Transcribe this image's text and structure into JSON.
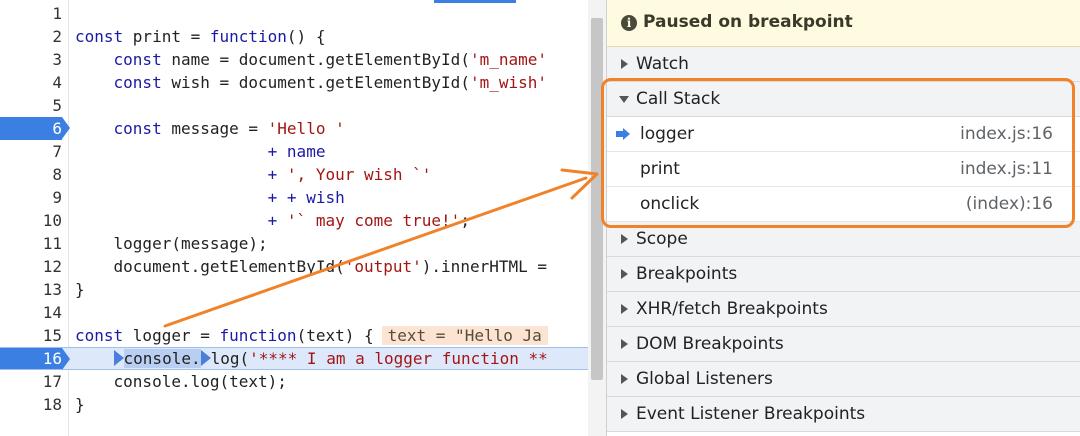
{
  "editor": {
    "lines": [
      {
        "n": "1",
        "parts": []
      },
      {
        "n": "2",
        "parts": [
          [
            "kw",
            "const "
          ],
          [
            "",
            "print = "
          ],
          [
            "kw",
            "function"
          ],
          [
            "",
            "() {"
          ]
        ]
      },
      {
        "n": "3",
        "parts": [
          [
            "",
            "    "
          ],
          [
            "kw",
            "const "
          ],
          [
            "",
            "name = document.getElementById("
          ],
          [
            "str",
            "'m_name'"
          ]
        ]
      },
      {
        "n": "4",
        "parts": [
          [
            "",
            "    "
          ],
          [
            "kw",
            "const "
          ],
          [
            "",
            "wish = document.getElementById("
          ],
          [
            "str",
            "'m_wish'"
          ]
        ]
      },
      {
        "n": "5",
        "parts": []
      },
      {
        "n": "6",
        "bp": true,
        "parts": [
          [
            "",
            "    "
          ],
          [
            "kw",
            "const "
          ],
          [
            "",
            "message = "
          ],
          [
            "str",
            "'Hello '"
          ]
        ]
      },
      {
        "n": "7",
        "parts": [
          [
            "",
            "                    "
          ],
          [
            "kw",
            "+ name"
          ]
        ]
      },
      {
        "n": "8",
        "parts": [
          [
            "",
            "                    "
          ],
          [
            "kw",
            "+ "
          ],
          [
            "str",
            "', Your wish `'"
          ]
        ]
      },
      {
        "n": "9",
        "parts": [
          [
            "",
            "                    "
          ],
          [
            "kw",
            "+ + wish"
          ]
        ]
      },
      {
        "n": "10",
        "parts": [
          [
            "",
            "                    "
          ],
          [
            "kw",
            "+ "
          ],
          [
            "str",
            "'` may come true!'"
          ],
          [
            "",
            ";"
          ]
        ]
      },
      {
        "n": "11",
        "parts": [
          [
            "",
            "    logger(message);"
          ]
        ]
      },
      {
        "n": "12",
        "parts": [
          [
            "",
            "    document.getElementById("
          ],
          [
            "str",
            "'output'"
          ],
          [
            "",
            ").innerHTML ="
          ]
        ]
      },
      {
        "n": "13",
        "parts": [
          [
            "",
            "}"
          ]
        ]
      },
      {
        "n": "14",
        "parts": []
      },
      {
        "n": "15",
        "parts": [
          [
            "kw",
            "const "
          ],
          [
            "",
            "logger = "
          ],
          [
            "kw",
            "function"
          ],
          [
            "",
            "(text) {"
          ]
        ],
        "inline": "text = \"Hello Ja"
      },
      {
        "n": "16",
        "bp": true,
        "exec": true,
        "parts": [
          [
            "",
            "    "
          ],
          [
            "mark",
            ""
          ],
          [
            "hl",
            "console."
          ],
          [
            "mark",
            ""
          ],
          [
            "",
            "log("
          ],
          [
            "str",
            "'**** I am a logger function **"
          ]
        ]
      },
      {
        "n": "17",
        "parts": [
          [
            "",
            "    console.log(text);"
          ]
        ]
      },
      {
        "n": "18",
        "parts": [
          [
            "",
            "}"
          ]
        ]
      }
    ]
  },
  "debugger": {
    "paused_message": "Paused on breakpoint",
    "info_icon": "i",
    "sections_top": [
      {
        "label": "Watch",
        "expanded": false
      }
    ],
    "call_stack": {
      "label": "Call Stack",
      "expanded": true,
      "frames": [
        {
          "name": "logger",
          "location": "index.js:16",
          "current": true
        },
        {
          "name": "print",
          "location": "index.js:11",
          "current": false
        },
        {
          "name": "onclick",
          "location": "(index):16",
          "current": false
        }
      ]
    },
    "sections_bottom": [
      {
        "label": "Scope"
      },
      {
        "label": "Breakpoints"
      },
      {
        "label": "XHR/fetch Breakpoints"
      },
      {
        "label": "DOM Breakpoints"
      },
      {
        "label": "Global Listeners"
      },
      {
        "label": "Event Listener Breakpoints"
      }
    ]
  },
  "colors": {
    "breakpoint": "#3b7fe3",
    "annotation": "#f0832a",
    "paused_bg": "#fffbe0"
  }
}
